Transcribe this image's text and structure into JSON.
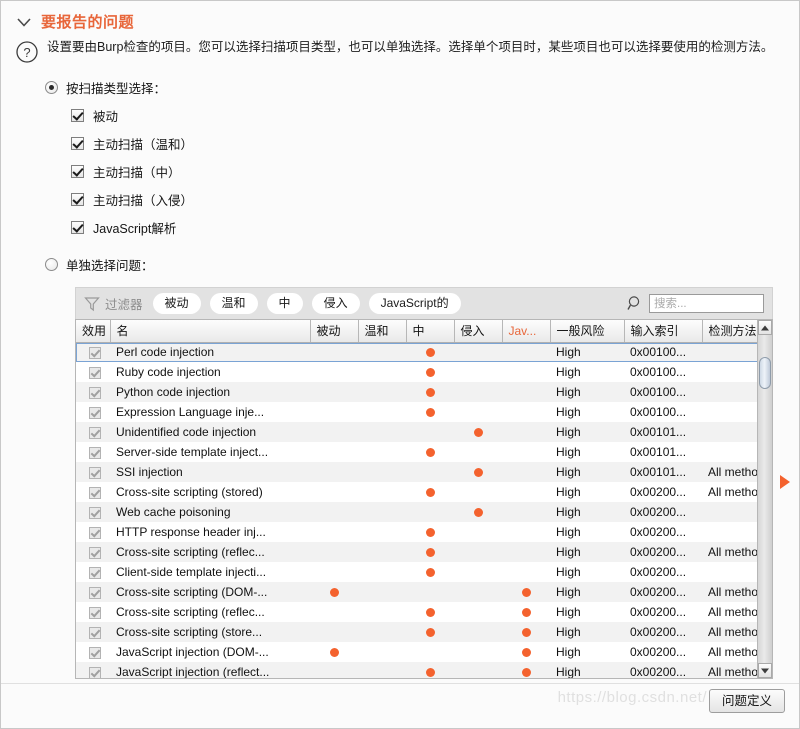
{
  "section": {
    "title": "要报告的问题",
    "description": "设置要由Burp检查的项目。您可以选择扫描项目类型，也可以单独选择。选择单个项目时，某些项目也可以选择要使用的检测方法。",
    "chevron_icon": "chevron-down-icon",
    "help_icon": "question-mark-icon",
    "accent_color": "#e8663a"
  },
  "options": {
    "by_type": {
      "label": "按扫描类型选择：",
      "selected": true
    },
    "individual": {
      "label": "单独选择问题：",
      "selected": false
    },
    "scan_types": [
      {
        "label": "被动",
        "checked": true
      },
      {
        "label": "主动扫描（温和）",
        "checked": true
      },
      {
        "label": "主动扫描（中）",
        "checked": true
      },
      {
        "label": "主动扫描（入侵）",
        "checked": true
      },
      {
        "label": "JavaScript解析",
        "checked": true
      }
    ]
  },
  "filter": {
    "icon": "funnel-icon",
    "label": "过滤器",
    "pills": [
      "被动",
      "温和",
      "中",
      "侵入",
      "JavaScript的"
    ],
    "search_icon": "magnifier-icon",
    "search_value": "",
    "search_placeholder": "搜索..."
  },
  "table": {
    "columns": [
      "效用",
      "名",
      "被动",
      "温和",
      "中",
      "侵入",
      "Jav...",
      "一般风险",
      "输入索引",
      "检测方法"
    ],
    "highlight_column_index": 6,
    "dot_color": "#f4622e",
    "rows": [
      {
        "enabled": true,
        "name": "Perl code injection",
        "passive": false,
        "light": false,
        "medium": true,
        "intrusive": false,
        "js": false,
        "risk": "High",
        "index": "0x00100...",
        "method": ""
      },
      {
        "enabled": true,
        "name": "Ruby code injection",
        "passive": false,
        "light": false,
        "medium": true,
        "intrusive": false,
        "js": false,
        "risk": "High",
        "index": "0x00100...",
        "method": ""
      },
      {
        "enabled": true,
        "name": "Python code injection",
        "passive": false,
        "light": false,
        "medium": true,
        "intrusive": false,
        "js": false,
        "risk": "High",
        "index": "0x00100...",
        "method": ""
      },
      {
        "enabled": true,
        "name": "Expression Language inje...",
        "passive": false,
        "light": false,
        "medium": true,
        "intrusive": false,
        "js": false,
        "risk": "High",
        "index": "0x00100...",
        "method": ""
      },
      {
        "enabled": true,
        "name": "Unidentified code injection",
        "passive": false,
        "light": false,
        "medium": false,
        "intrusive": true,
        "js": false,
        "risk": "High",
        "index": "0x00101...",
        "method": ""
      },
      {
        "enabled": true,
        "name": "Server-side template inject...",
        "passive": false,
        "light": false,
        "medium": true,
        "intrusive": false,
        "js": false,
        "risk": "High",
        "index": "0x00101...",
        "method": ""
      },
      {
        "enabled": true,
        "name": "SSI injection",
        "passive": false,
        "light": false,
        "medium": false,
        "intrusive": true,
        "js": false,
        "risk": "High",
        "index": "0x00101...",
        "method": "All methods ena..."
      },
      {
        "enabled": true,
        "name": "Cross-site scripting (stored)",
        "passive": false,
        "light": false,
        "medium": true,
        "intrusive": false,
        "js": false,
        "risk": "High",
        "index": "0x00200...",
        "method": "All methods ena..."
      },
      {
        "enabled": true,
        "name": "Web cache poisoning",
        "passive": false,
        "light": false,
        "medium": false,
        "intrusive": true,
        "js": false,
        "risk": "High",
        "index": "0x00200...",
        "method": ""
      },
      {
        "enabled": true,
        "name": "HTTP response header inj...",
        "passive": false,
        "light": false,
        "medium": true,
        "intrusive": false,
        "js": false,
        "risk": "High",
        "index": "0x00200...",
        "method": ""
      },
      {
        "enabled": true,
        "name": "Cross-site scripting (reflec...",
        "passive": false,
        "light": false,
        "medium": true,
        "intrusive": false,
        "js": false,
        "risk": "High",
        "index": "0x00200...",
        "method": "All methods ena..."
      },
      {
        "enabled": true,
        "name": "Client-side template injecti...",
        "passive": false,
        "light": false,
        "medium": true,
        "intrusive": false,
        "js": false,
        "risk": "High",
        "index": "0x00200...",
        "method": ""
      },
      {
        "enabled": true,
        "name": "Cross-site scripting (DOM-...",
        "passive": true,
        "light": false,
        "medium": false,
        "intrusive": false,
        "js": true,
        "risk": "High",
        "index": "0x00200...",
        "method": "All methods ena..."
      },
      {
        "enabled": true,
        "name": "Cross-site scripting (reflec...",
        "passive": false,
        "light": false,
        "medium": true,
        "intrusive": false,
        "js": true,
        "risk": "High",
        "index": "0x00200...",
        "method": "All methods ena..."
      },
      {
        "enabled": true,
        "name": "Cross-site scripting (store...",
        "passive": false,
        "light": false,
        "medium": true,
        "intrusive": false,
        "js": true,
        "risk": "High",
        "index": "0x00200...",
        "method": "All methods ena..."
      },
      {
        "enabled": true,
        "name": "JavaScript injection (DOM-...",
        "passive": true,
        "light": false,
        "medium": false,
        "intrusive": false,
        "js": true,
        "risk": "High",
        "index": "0x00200...",
        "method": "All methods ena..."
      },
      {
        "enabled": true,
        "name": "JavaScript injection (reflect...",
        "passive": false,
        "light": false,
        "medium": true,
        "intrusive": false,
        "js": true,
        "risk": "High",
        "index": "0x00200...",
        "method": "All methods ena..."
      }
    ]
  },
  "footer": {
    "definitions_button": "问题定义",
    "watermark": "https://blog.csdn.net/"
  }
}
